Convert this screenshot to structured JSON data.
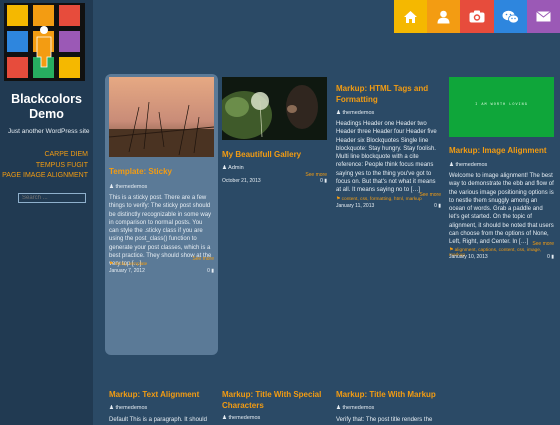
{
  "site": {
    "title": "Blackcolors Demo",
    "description": "Just another WordPress site"
  },
  "nav": [
    "CARPE DIEM",
    "TEMPUS FUGIT",
    "PAGE IMAGE ALIGNMENT"
  ],
  "search": {
    "placeholder": "Search ..."
  },
  "social": [
    {
      "icon": "home-icon",
      "color": "#f5b800"
    },
    {
      "icon": "user-icon",
      "color": "#f39c12"
    },
    {
      "icon": "camera-icon",
      "color": "#e74c3c"
    },
    {
      "icon": "wechat-icon",
      "color": "#2e86de"
    },
    {
      "icon": "mail-icon",
      "color": "#9b59b6"
    }
  ],
  "posts": [
    {
      "title": "Template: Sticky",
      "author": "themedemos",
      "excerpt": "This is a sticky post. There are a few things to verify: The sticky post should be distinctly recognizable in some way in comparison to normal posts. You can style the .sticky class if you are using the post_class() function to generate your post classes, which is a best practice. They should show at the very top […]",
      "see_more": "See more",
      "tags": "sticky, template",
      "date": "January 7, 2012",
      "comments": "0"
    },
    {
      "title": "My Beautifull Gallery",
      "author": "Admin",
      "see_more": "See more",
      "date": "October 21, 2013",
      "comments": "0"
    },
    {
      "title": "Markup: HTML Tags and Formatting",
      "author": "themedemos",
      "excerpt": "Headings Header one Header two Header three Header four Header five Header six Blockquotes Single line blockquote: Stay hungry. Stay foolish. Multi line blockquote with a cite reference: People think focus means saying yes to the thing you've got to focus on. But that's not what it means at all. It means saying no to […]",
      "see_more": "See more",
      "tags": "content, css, formatting, html, markup",
      "date": "January 11, 2013",
      "comments": "0"
    },
    {
      "title": "Markup: Image Alignment",
      "author": "themedemos",
      "image_text": "I AM WORTH LOVING",
      "excerpt": "Welcome to image alignment! The best way to demonstrate the ebb and flow of the various image positioning options is to nestle them snuggly among an ocean of words. Grab a paddle and let's get started. On the topic of alignment, it should be noted that users can choose from the options of None, Left, Right, and Center. In […]",
      "see_more": "See more",
      "tags": "alignment, captions, content, css, image, markup",
      "date": "January 10, 2013",
      "comments": "0"
    },
    {
      "title": "Markup: Text Alignment",
      "author": "themedemos",
      "excerpt": "Default This is a paragraph. It should"
    },
    {
      "title": "Markup: Title With Special Characters",
      "author": "themedemos"
    },
    {
      "title": "Markup: Title With Markup",
      "author": "themedemos",
      "excerpt": "Verify that: The post title renders the"
    }
  ]
}
